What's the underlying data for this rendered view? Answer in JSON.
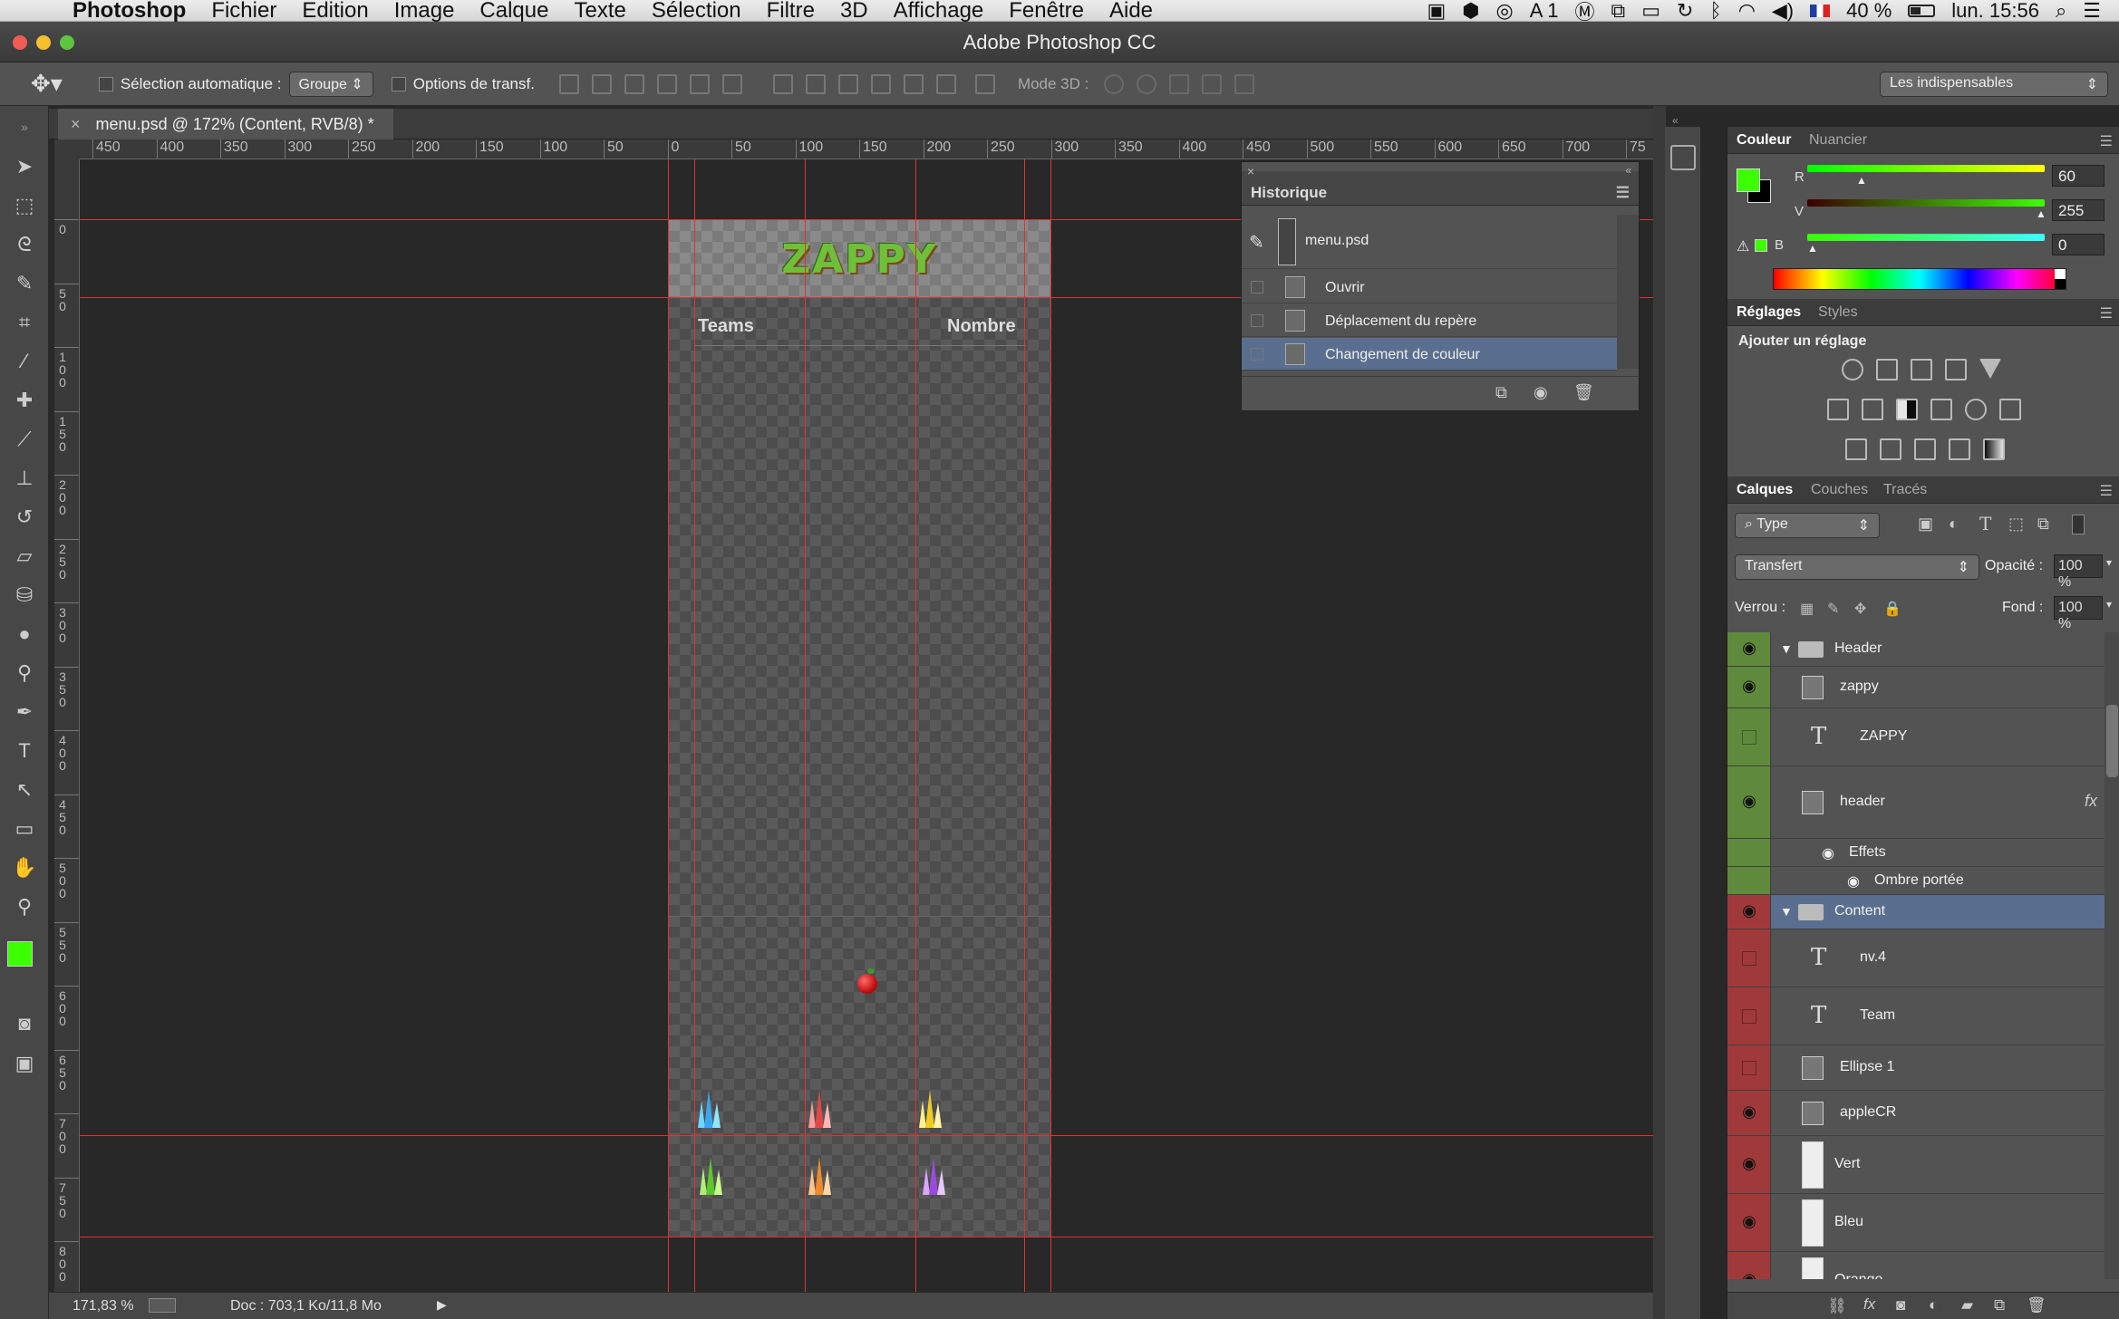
{
  "menubar": {
    "app_name": "Photoshop",
    "items": [
      "Fichier",
      "Edition",
      "Image",
      "Calque",
      "Texte",
      "Sélection",
      "Filtre",
      "3D",
      "Affichage",
      "Fenêtre",
      "Aide"
    ],
    "status_a1": "1",
    "battery": "40 %",
    "clock": "lun. 15:56"
  },
  "window": {
    "title": "Adobe Photoshop CC"
  },
  "options": {
    "auto_select_label": "Sélection automatique :",
    "auto_select_value": "Groupe",
    "transform_label": "Options de transf.",
    "mode3d_label": "Mode 3D :",
    "workspace": "Les indispensables"
  },
  "document": {
    "tab_title": "menu.psd @ 172% (Content, RVB/8) *",
    "logo_text": "ZAPPY",
    "col_teams": "Teams",
    "col_count": "Nombre"
  },
  "ruler": {
    "h_ticks": [
      "450",
      "400",
      "350",
      "300",
      "250",
      "200",
      "150",
      "100",
      "50",
      "0",
      "50",
      "100",
      "150",
      "200",
      "250",
      "300",
      "350",
      "400",
      "450",
      "500",
      "550",
      "600",
      "650",
      "700",
      "75"
    ],
    "v_ticks": [
      "0",
      "50",
      "100",
      "150",
      "200",
      "250",
      "300",
      "350",
      "400",
      "450",
      "500",
      "550",
      "600",
      "650",
      "700",
      "750",
      "800"
    ]
  },
  "history": {
    "title": "Historique",
    "snapshot": "menu.psd",
    "steps": [
      "Ouvrir",
      "Déplacement du repère",
      "Changement de couleur"
    ],
    "active_index": 2
  },
  "color_panel": {
    "tabs": [
      "Couleur",
      "Nuancier"
    ],
    "r_label": "R",
    "g_label": "V",
    "b_label": "B",
    "r": "60",
    "g": "255",
    "b": "0",
    "foreground": "#3cff00",
    "background": "#000000"
  },
  "adjust_panel": {
    "tabs": [
      "Réglages",
      "Styles"
    ],
    "heading": "Ajouter un réglage"
  },
  "layers_panel": {
    "tabs": [
      "Calques",
      "Couches",
      "Tracés"
    ],
    "filter": "Type",
    "blend_mode": "Transfert",
    "opacity_label": "Opacité :",
    "opacity": "100 %",
    "lock_label": "Verrou :",
    "fill_label": "Fond :",
    "fill": "100 %",
    "layers": [
      {
        "name": "Header",
        "kind": "group",
        "visible": true,
        "color": "green"
      },
      {
        "name": "zappy",
        "kind": "smart",
        "visible": true,
        "color": "green"
      },
      {
        "name": "ZAPPY",
        "kind": "text",
        "visible": false,
        "color": "green"
      },
      {
        "name": "header",
        "kind": "smart",
        "visible": true,
        "color": "green",
        "fx": "fx"
      },
      {
        "name": "Effets",
        "kind": "effect",
        "visible": true,
        "color": "green"
      },
      {
        "name": "Ombre portée",
        "kind": "effect",
        "visible": true,
        "color": "green"
      },
      {
        "name": "Content",
        "kind": "group",
        "visible": true,
        "color": "red",
        "selected": true
      },
      {
        "name": "nv.4",
        "kind": "text",
        "visible": false,
        "color": "red"
      },
      {
        "name": "Team",
        "kind": "text",
        "visible": false,
        "color": "red"
      },
      {
        "name": "Ellipse 1",
        "kind": "smart",
        "visible": false,
        "color": "red"
      },
      {
        "name": "appleCR",
        "kind": "smart",
        "visible": true,
        "color": "red"
      },
      {
        "name": "Vert",
        "kind": "pixel",
        "visible": true,
        "color": "red"
      },
      {
        "name": "Bleu",
        "kind": "pixel",
        "visible": true,
        "color": "red"
      },
      {
        "name": "Orange",
        "kind": "pixel",
        "visible": true,
        "color": "red"
      }
    ]
  },
  "status": {
    "zoom": "171,83 %",
    "doc": "Doc : 703,1 Ko/11,8 Mo"
  },
  "colors": {
    "label_green": "#5f8a3c",
    "label_red": "#a03a3a",
    "guide": "#dd3333",
    "selected_row": "#5a6f8f"
  }
}
